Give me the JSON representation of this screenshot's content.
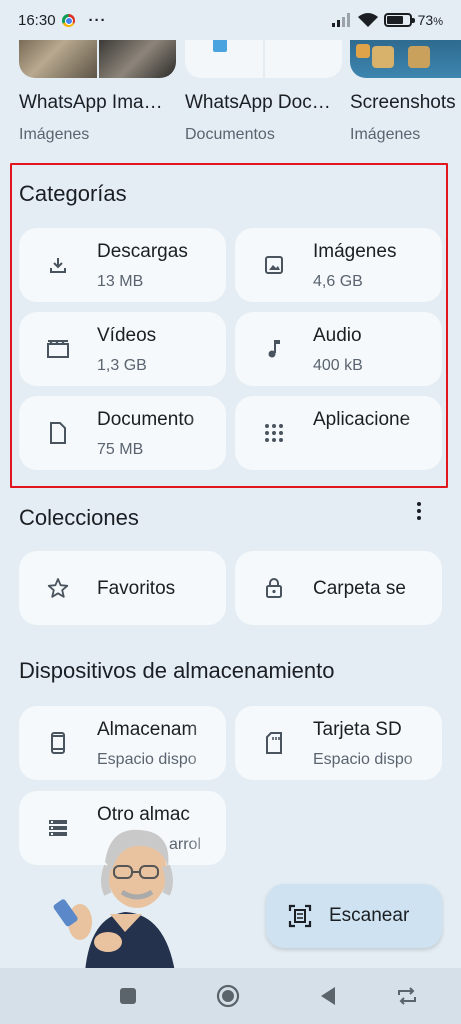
{
  "status_bar": {
    "time": "16:30",
    "more": "···",
    "battery": "73",
    "battery_level": 0.73
  },
  "recent": [
    {
      "title": "WhatsApp Ima…",
      "subtitle": "Imágenes"
    },
    {
      "title": "WhatsApp Doc…",
      "subtitle": "Documentos"
    },
    {
      "title": "Screenshots",
      "subtitle": "Imágenes"
    }
  ],
  "categories": {
    "title": "Categorías",
    "items": [
      {
        "label": "Descargas",
        "size": "13 MB",
        "icon": "download-icon"
      },
      {
        "label": "Imágenes",
        "size": "4,6 GB",
        "icon": "image-icon"
      },
      {
        "label": "Vídeos",
        "size": "1,3 GB",
        "icon": "video-icon"
      },
      {
        "label": "Audio",
        "size": "400 kB",
        "icon": "music-note-icon"
      },
      {
        "label": "Documento",
        "size": "75 MB",
        "icon": "document-icon"
      },
      {
        "label": "Aplicacione",
        "size": "",
        "icon": "apps-grid-icon"
      }
    ]
  },
  "collections": {
    "title": "Colecciones",
    "items": [
      {
        "label": "Favoritos",
        "icon": "star-icon"
      },
      {
        "label": "Carpeta se",
        "icon": "lock-icon"
      }
    ]
  },
  "storage": {
    "title": "Dispositivos de almacenamiento",
    "items": [
      {
        "label": "Almacenam",
        "sub": "Espacio dispo",
        "icon": "phone-icon"
      },
      {
        "label": "Tarjeta SD",
        "sub": "Espacio dispo",
        "icon": "sd-card-icon"
      },
      {
        "label": "Otro almac",
        "sub": "arrol",
        "icon": "storage-list-icon"
      }
    ]
  },
  "scan_button": {
    "label": "Escanear",
    "icon": "scan-icon"
  },
  "colors": {
    "background": "#e3edf3",
    "card": "#f6f9fb",
    "highlight": "#e0161c",
    "fab": "#cfe2f1"
  }
}
